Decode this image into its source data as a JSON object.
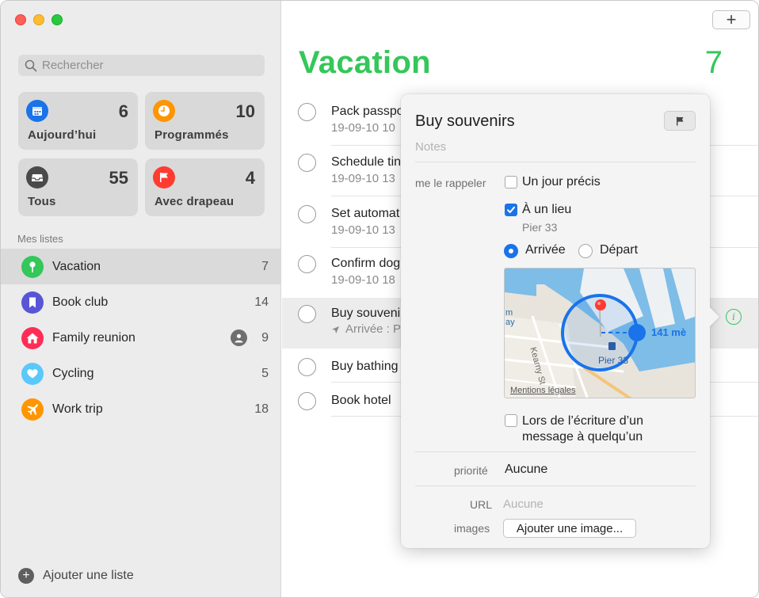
{
  "sidebar": {
    "search_placeholder": "Rechercher",
    "smart_lists": [
      {
        "label": "Aujourd’hui",
        "count": "6",
        "icon": "calendar-icon",
        "color": "#1a73e8"
      },
      {
        "label": "Programmés",
        "count": "10",
        "icon": "clock-icon",
        "color": "#ff9500"
      },
      {
        "label": "Tous",
        "count": "55",
        "icon": "tray-icon",
        "color": "#4a4a4a"
      },
      {
        "label": "Avec drapeau",
        "count": "4",
        "icon": "flag-icon",
        "color": "#ff3b30"
      }
    ],
    "section_title": "Mes listes",
    "lists": [
      {
        "label": "Vacation",
        "count": "7",
        "icon": "pin-icon",
        "color": "#34c759"
      },
      {
        "label": "Book club",
        "count": "14",
        "icon": "bookmark-icon",
        "color": "#5856d6"
      },
      {
        "label": "Family reunion",
        "count": "9",
        "icon": "house-icon",
        "color": "#ff2d55",
        "shared": true
      },
      {
        "label": "Cycling",
        "count": "5",
        "icon": "heart-icon",
        "color": "#5ac8fa"
      },
      {
        "label": "Work trip",
        "count": "18",
        "icon": "airplane-icon",
        "color": "#ff9500"
      }
    ],
    "add_list_label": "Ajouter une liste"
  },
  "main": {
    "add_button": "+",
    "title": "Vacation",
    "title_count": "7",
    "accent": "#34c759",
    "reminders": [
      {
        "title": "Pack passpo",
        "sub": "19-09-10 10"
      },
      {
        "title": "Schedule tin",
        "sub": "19-09-10 13"
      },
      {
        "title": "Set automat",
        "sub": "19-09-10 13"
      },
      {
        "title": "Confirm dog",
        "sub": "19-09-10 18"
      },
      {
        "title": "Buy souveni",
        "sub": "Arrivée : P",
        "selected": true
      },
      {
        "title": "Buy bathing",
        "sub": ""
      },
      {
        "title": "Book hotel",
        "sub": ""
      }
    ]
  },
  "popover": {
    "title": "Buy souvenirs",
    "notes_placeholder": "Notes",
    "remind_label": "me le rappeler",
    "on_day_label": "Un jour précis",
    "at_location_label": "À un lieu",
    "location_name": "Pier 33",
    "arrival_label": "Arrivée",
    "departure_label": "Départ",
    "map_distance": "141 mè",
    "map_pier_label": "Pier 33",
    "map_left_label": "m\nay",
    "map_street": "Kearny St",
    "map_legal": "Mentions légales",
    "messaging_label": "Lors de l’écriture d’un message à quelqu’un",
    "priority_label": "priorité",
    "priority_value": "Aucune",
    "url_label": "URL",
    "url_placeholder": "Aucune",
    "images_label": "images",
    "add_image_button": "Ajouter une image..."
  }
}
